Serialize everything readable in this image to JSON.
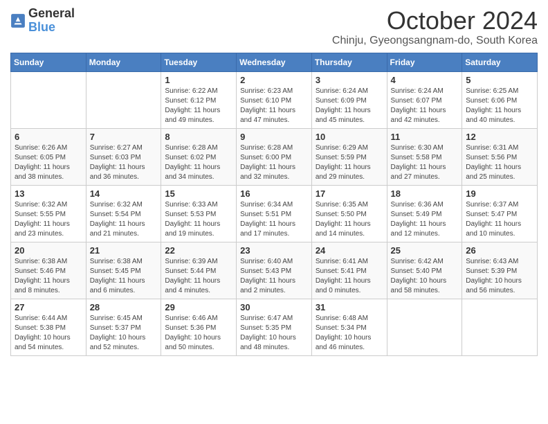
{
  "header": {
    "logo_general": "General",
    "logo_blue": "Blue",
    "month_title": "October 2024",
    "subtitle": "Chinju, Gyeongsangnam-do, South Korea"
  },
  "days_of_week": [
    "Sunday",
    "Monday",
    "Tuesday",
    "Wednesday",
    "Thursday",
    "Friday",
    "Saturday"
  ],
  "weeks": [
    [
      {
        "day": "",
        "sunrise": "",
        "sunset": "",
        "daylight": ""
      },
      {
        "day": "",
        "sunrise": "",
        "sunset": "",
        "daylight": ""
      },
      {
        "day": "1",
        "sunrise": "Sunrise: 6:22 AM",
        "sunset": "Sunset: 6:12 PM",
        "daylight": "Daylight: 11 hours and 49 minutes."
      },
      {
        "day": "2",
        "sunrise": "Sunrise: 6:23 AM",
        "sunset": "Sunset: 6:10 PM",
        "daylight": "Daylight: 11 hours and 47 minutes."
      },
      {
        "day": "3",
        "sunrise": "Sunrise: 6:24 AM",
        "sunset": "Sunset: 6:09 PM",
        "daylight": "Daylight: 11 hours and 45 minutes."
      },
      {
        "day": "4",
        "sunrise": "Sunrise: 6:24 AM",
        "sunset": "Sunset: 6:07 PM",
        "daylight": "Daylight: 11 hours and 42 minutes."
      },
      {
        "day": "5",
        "sunrise": "Sunrise: 6:25 AM",
        "sunset": "Sunset: 6:06 PM",
        "daylight": "Daylight: 11 hours and 40 minutes."
      }
    ],
    [
      {
        "day": "6",
        "sunrise": "Sunrise: 6:26 AM",
        "sunset": "Sunset: 6:05 PM",
        "daylight": "Daylight: 11 hours and 38 minutes."
      },
      {
        "day": "7",
        "sunrise": "Sunrise: 6:27 AM",
        "sunset": "Sunset: 6:03 PM",
        "daylight": "Daylight: 11 hours and 36 minutes."
      },
      {
        "day": "8",
        "sunrise": "Sunrise: 6:28 AM",
        "sunset": "Sunset: 6:02 PM",
        "daylight": "Daylight: 11 hours and 34 minutes."
      },
      {
        "day": "9",
        "sunrise": "Sunrise: 6:28 AM",
        "sunset": "Sunset: 6:00 PM",
        "daylight": "Daylight: 11 hours and 32 minutes."
      },
      {
        "day": "10",
        "sunrise": "Sunrise: 6:29 AM",
        "sunset": "Sunset: 5:59 PM",
        "daylight": "Daylight: 11 hours and 29 minutes."
      },
      {
        "day": "11",
        "sunrise": "Sunrise: 6:30 AM",
        "sunset": "Sunset: 5:58 PM",
        "daylight": "Daylight: 11 hours and 27 minutes."
      },
      {
        "day": "12",
        "sunrise": "Sunrise: 6:31 AM",
        "sunset": "Sunset: 5:56 PM",
        "daylight": "Daylight: 11 hours and 25 minutes."
      }
    ],
    [
      {
        "day": "13",
        "sunrise": "Sunrise: 6:32 AM",
        "sunset": "Sunset: 5:55 PM",
        "daylight": "Daylight: 11 hours and 23 minutes."
      },
      {
        "day": "14",
        "sunrise": "Sunrise: 6:32 AM",
        "sunset": "Sunset: 5:54 PM",
        "daylight": "Daylight: 11 hours and 21 minutes."
      },
      {
        "day": "15",
        "sunrise": "Sunrise: 6:33 AM",
        "sunset": "Sunset: 5:53 PM",
        "daylight": "Daylight: 11 hours and 19 minutes."
      },
      {
        "day": "16",
        "sunrise": "Sunrise: 6:34 AM",
        "sunset": "Sunset: 5:51 PM",
        "daylight": "Daylight: 11 hours and 17 minutes."
      },
      {
        "day": "17",
        "sunrise": "Sunrise: 6:35 AM",
        "sunset": "Sunset: 5:50 PM",
        "daylight": "Daylight: 11 hours and 14 minutes."
      },
      {
        "day": "18",
        "sunrise": "Sunrise: 6:36 AM",
        "sunset": "Sunset: 5:49 PM",
        "daylight": "Daylight: 11 hours and 12 minutes."
      },
      {
        "day": "19",
        "sunrise": "Sunrise: 6:37 AM",
        "sunset": "Sunset: 5:47 PM",
        "daylight": "Daylight: 11 hours and 10 minutes."
      }
    ],
    [
      {
        "day": "20",
        "sunrise": "Sunrise: 6:38 AM",
        "sunset": "Sunset: 5:46 PM",
        "daylight": "Daylight: 11 hours and 8 minutes."
      },
      {
        "day": "21",
        "sunrise": "Sunrise: 6:38 AM",
        "sunset": "Sunset: 5:45 PM",
        "daylight": "Daylight: 11 hours and 6 minutes."
      },
      {
        "day": "22",
        "sunrise": "Sunrise: 6:39 AM",
        "sunset": "Sunset: 5:44 PM",
        "daylight": "Daylight: 11 hours and 4 minutes."
      },
      {
        "day": "23",
        "sunrise": "Sunrise: 6:40 AM",
        "sunset": "Sunset: 5:43 PM",
        "daylight": "Daylight: 11 hours and 2 minutes."
      },
      {
        "day": "24",
        "sunrise": "Sunrise: 6:41 AM",
        "sunset": "Sunset: 5:41 PM",
        "daylight": "Daylight: 11 hours and 0 minutes."
      },
      {
        "day": "25",
        "sunrise": "Sunrise: 6:42 AM",
        "sunset": "Sunset: 5:40 PM",
        "daylight": "Daylight: 10 hours and 58 minutes."
      },
      {
        "day": "26",
        "sunrise": "Sunrise: 6:43 AM",
        "sunset": "Sunset: 5:39 PM",
        "daylight": "Daylight: 10 hours and 56 minutes."
      }
    ],
    [
      {
        "day": "27",
        "sunrise": "Sunrise: 6:44 AM",
        "sunset": "Sunset: 5:38 PM",
        "daylight": "Daylight: 10 hours and 54 minutes."
      },
      {
        "day": "28",
        "sunrise": "Sunrise: 6:45 AM",
        "sunset": "Sunset: 5:37 PM",
        "daylight": "Daylight: 10 hours and 52 minutes."
      },
      {
        "day": "29",
        "sunrise": "Sunrise: 6:46 AM",
        "sunset": "Sunset: 5:36 PM",
        "daylight": "Daylight: 10 hours and 50 minutes."
      },
      {
        "day": "30",
        "sunrise": "Sunrise: 6:47 AM",
        "sunset": "Sunset: 5:35 PM",
        "daylight": "Daylight: 10 hours and 48 minutes."
      },
      {
        "day": "31",
        "sunrise": "Sunrise: 6:48 AM",
        "sunset": "Sunset: 5:34 PM",
        "daylight": "Daylight: 10 hours and 46 minutes."
      },
      {
        "day": "",
        "sunrise": "",
        "sunset": "",
        "daylight": ""
      },
      {
        "day": "",
        "sunrise": "",
        "sunset": "",
        "daylight": ""
      }
    ]
  ]
}
